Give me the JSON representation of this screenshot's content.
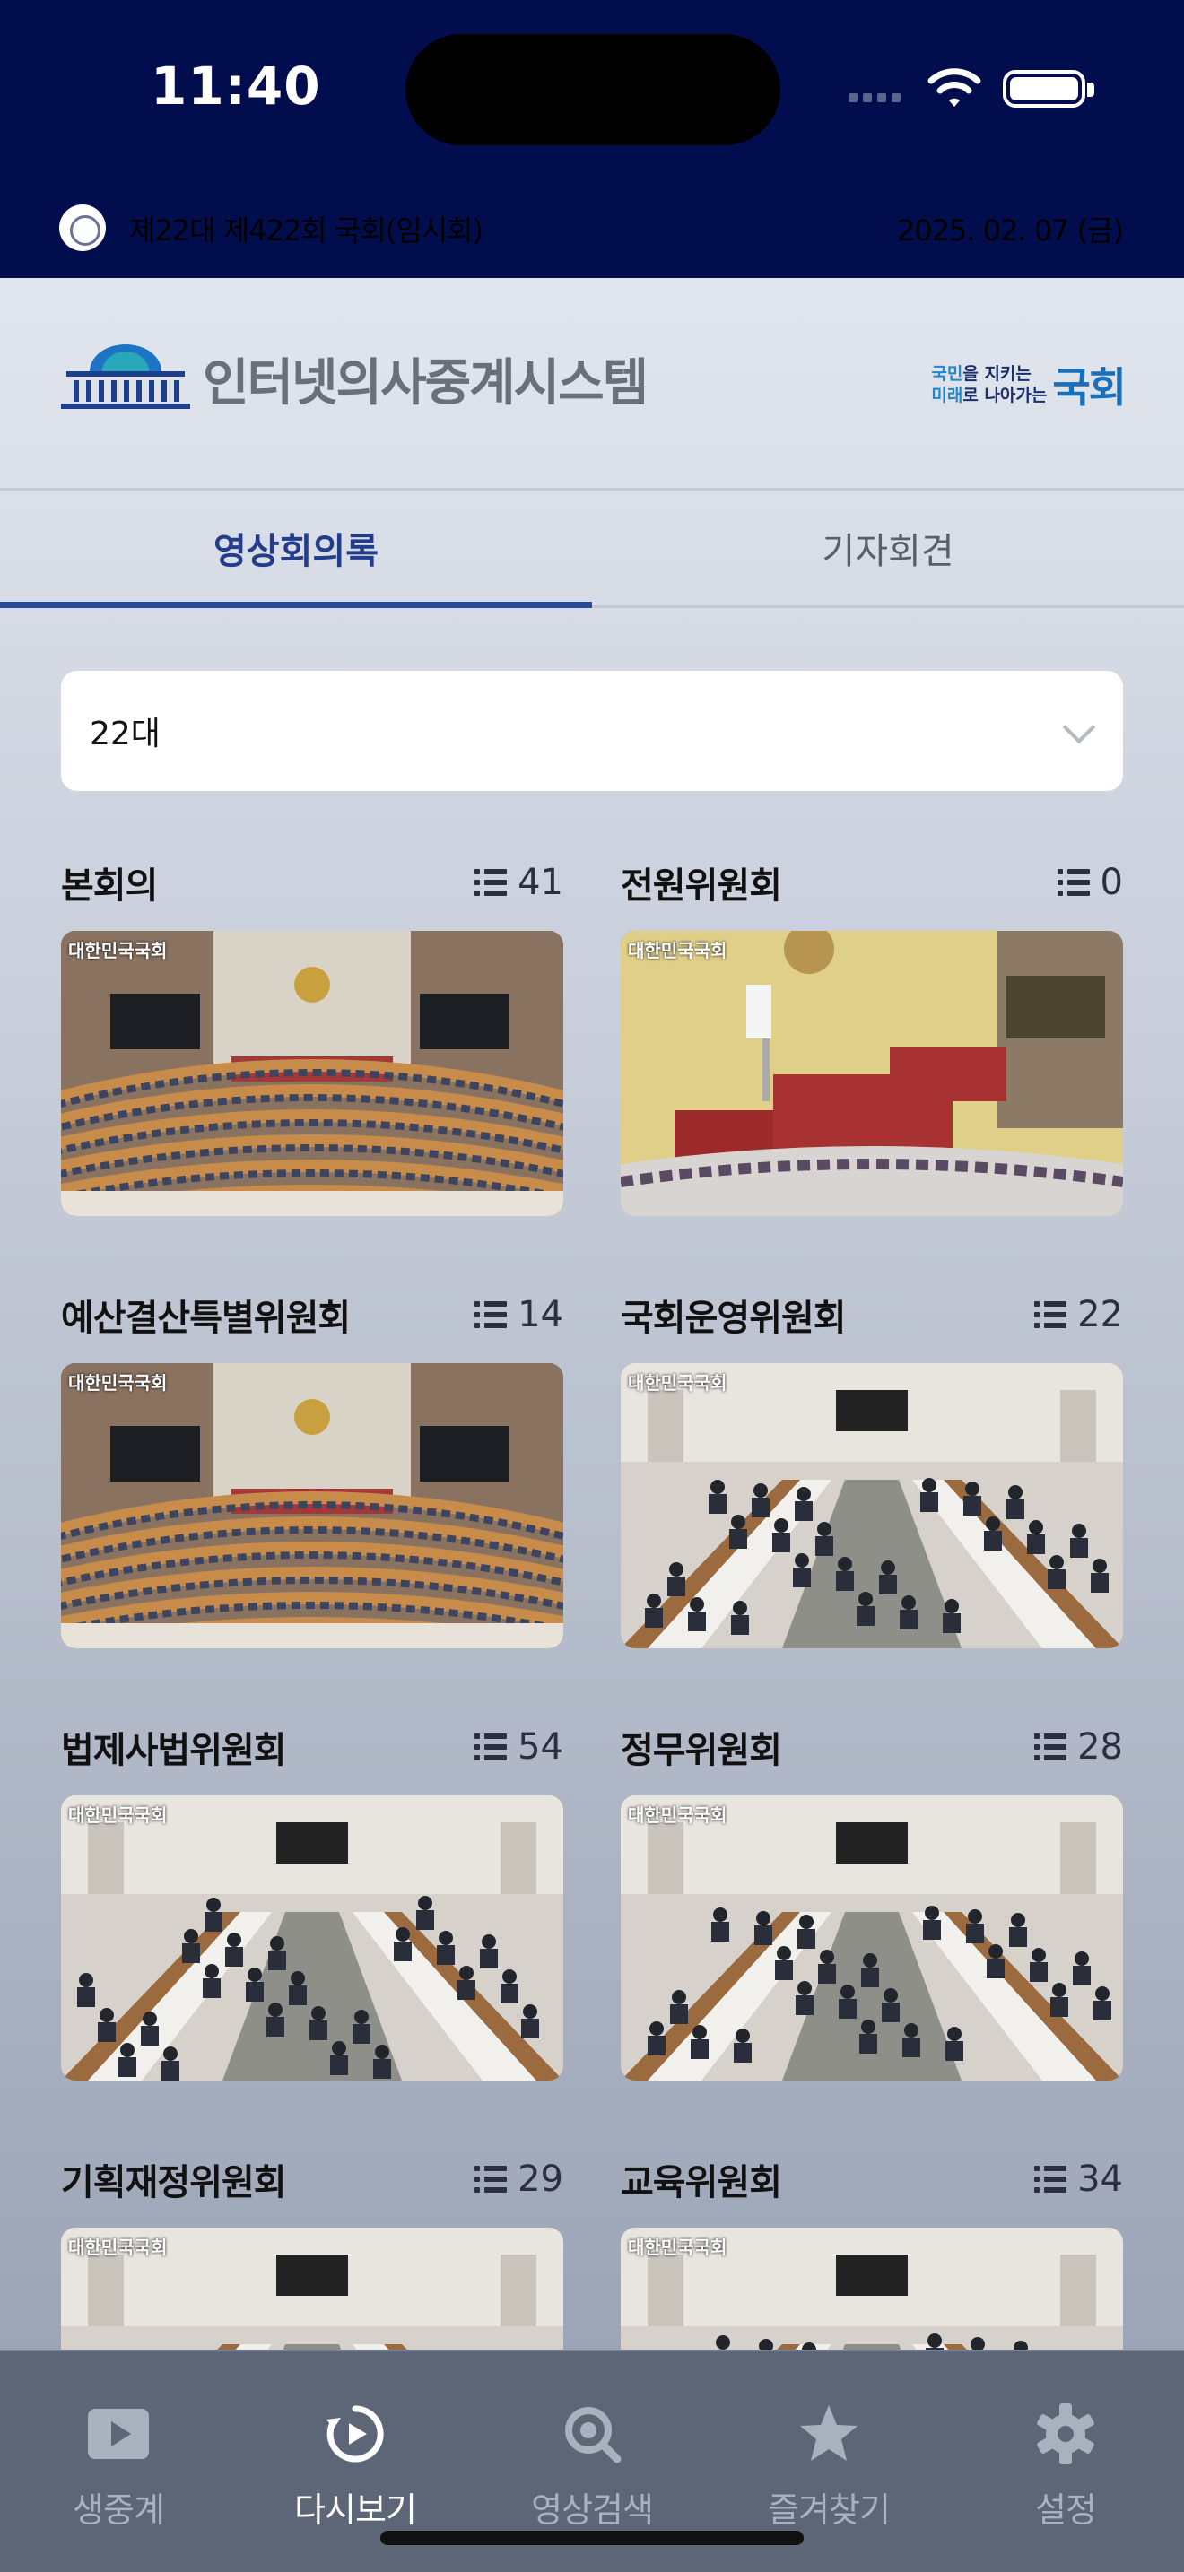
{
  "status_bar": {
    "time": "11:40"
  },
  "session": {
    "title": "제22대 제422회 국회(임시회)",
    "date": "2025. 02. 07 (금)"
  },
  "header": {
    "logo_text": "인터넷의사중계시스템",
    "slogan_line1_pre": "국민",
    "slogan_line1_post": "을 지키는",
    "slogan_line2_pre": "미래",
    "slogan_line2_post": "로 나아가는",
    "slogan_big": "국회"
  },
  "tabs": [
    {
      "label": "영상회의록",
      "active": true
    },
    {
      "label": "기자회견",
      "active": false
    }
  ],
  "select": {
    "value": "22대"
  },
  "thumbnail_watermark": "대한민국국회",
  "committees": [
    {
      "name": "본회의",
      "count": "41"
    },
    {
      "name": "전원위원회",
      "count": "0"
    },
    {
      "name": "예산결산특별위원회",
      "count": "14"
    },
    {
      "name": "국회운영위원회",
      "count": "22"
    },
    {
      "name": "법제사법위원회",
      "count": "54"
    },
    {
      "name": "정무위원회",
      "count": "28"
    },
    {
      "name": "기획재정위원회",
      "count": "29"
    },
    {
      "name": "교육위원회",
      "count": "34"
    }
  ],
  "bottom_nav": [
    {
      "label": "생중계",
      "icon": "play-icon",
      "active": false
    },
    {
      "label": "다시보기",
      "icon": "replay-icon",
      "active": true
    },
    {
      "label": "영상검색",
      "icon": "search-icon",
      "active": false
    },
    {
      "label": "즐겨찾기",
      "icon": "star-icon",
      "active": false
    },
    {
      "label": "설정",
      "icon": "gear-icon",
      "active": false
    }
  ]
}
